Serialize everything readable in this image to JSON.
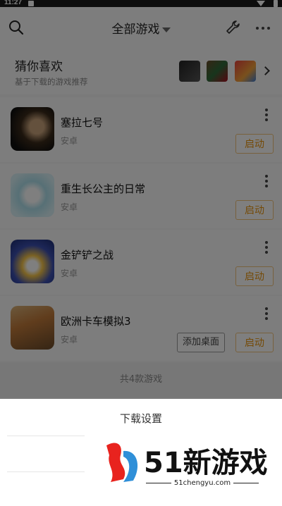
{
  "status": {
    "time": "11:27"
  },
  "header": {
    "title": "全部游戏"
  },
  "recommend": {
    "title": "猜你喜欢",
    "subtitle": "基于下载的游戏推荐"
  },
  "games": [
    {
      "name": "塞拉七号",
      "platform": "安卓",
      "start": "启动"
    },
    {
      "name": "重生长公主的日常",
      "platform": "安卓",
      "start": "启动"
    },
    {
      "name": "金铲铲之战",
      "platform": "安卓",
      "start": "启动"
    },
    {
      "name": "欧洲卡车模拟3",
      "platform": "安卓",
      "start": "启动",
      "add_desktop": "添加桌面"
    }
  ],
  "footer": {
    "count": "共4款游戏"
  },
  "sheet": {
    "title": "下载设置"
  },
  "watermark": {
    "brand": "51新游戏",
    "url": "51chengyu.com"
  },
  "colors": {
    "accent": "#e8950f",
    "dim_overlay": "rgba(0,0,0,0.5)"
  },
  "icons": [
    "search-icon",
    "wrench-icon",
    "more-icon",
    "chevron-right-icon",
    "kebab-icon"
  ]
}
